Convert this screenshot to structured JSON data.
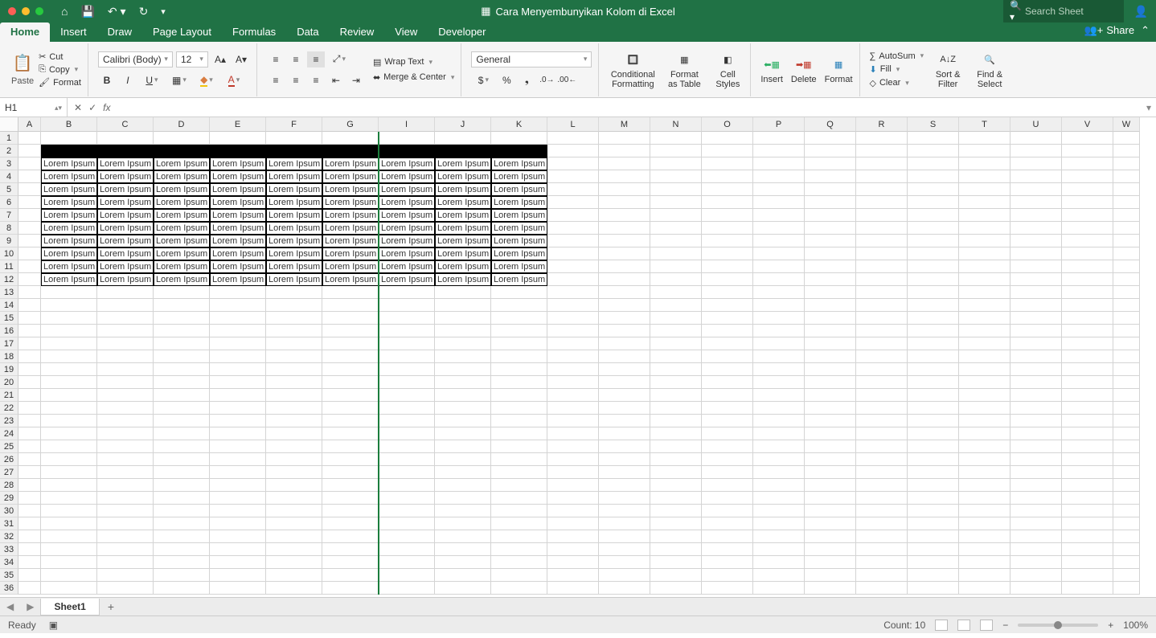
{
  "title": "Cara Menyembunyikan Kolom di Excel",
  "search_placeholder": "Search Sheet",
  "share": "Share",
  "tabs": [
    "Home",
    "Insert",
    "Draw",
    "Page Layout",
    "Formulas",
    "Data",
    "Review",
    "View",
    "Developer"
  ],
  "clipboard": {
    "paste": "Paste",
    "cut": "Cut",
    "copy": "Copy",
    "format": "Format"
  },
  "font": {
    "name": "Calibri (Body)",
    "size": "12"
  },
  "align": {
    "wrap": "Wrap Text",
    "merge": "Merge & Center"
  },
  "number": {
    "format": "General"
  },
  "cond": {
    "cond": "Conditional Formatting",
    "table": "Format as Table",
    "styles": "Cell Styles"
  },
  "cells": {
    "insert": "Insert",
    "delete": "Delete",
    "format": "Format"
  },
  "edit": {
    "sum": "AutoSum",
    "fill": "Fill",
    "clear": "Clear",
    "sort": "Sort & Filter",
    "find": "Find & Select"
  },
  "namebox": "H1",
  "columns": [
    "A",
    "B",
    "C",
    "D",
    "E",
    "F",
    "G",
    "I",
    "J",
    "K",
    "L",
    "M",
    "N",
    "O",
    "P",
    "Q",
    "R",
    "S",
    "T",
    "U",
    "V",
    "W"
  ],
  "cw": [
    28,
    70,
    70,
    70,
    70,
    70,
    70,
    70,
    70,
    70,
    64,
    64,
    64,
    64,
    64,
    64,
    64,
    64,
    64,
    64,
    64,
    33
  ],
  "rows": 36,
  "cell_text": "Lorem Ipsum",
  "sheet": "Sheet1",
  "status": {
    "ready": "Ready",
    "count": "Count: 10",
    "zoom": "100%"
  }
}
